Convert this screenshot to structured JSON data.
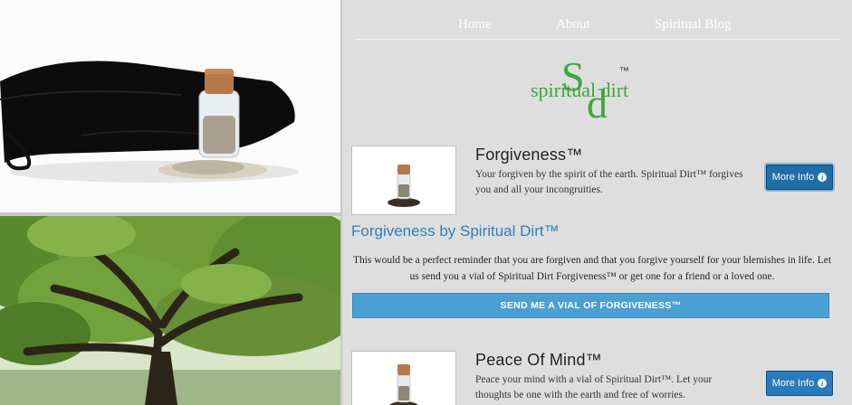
{
  "nav": {
    "home": "Home",
    "about": "About",
    "blog": "Spiritual Blog"
  },
  "logo": {
    "monogram_s": "S",
    "monogram_d": "d",
    "wordmark": "spiritual dirt",
    "tm": "™",
    "color": "#3aa83a"
  },
  "products": [
    {
      "title": "Forgiveness™",
      "description": "Your forgiven by the spirit of the earth. Spiritual Dirt™ forgives you and all your incongruities.",
      "button": "More Info"
    },
    {
      "title": "Peace Of Mind™",
      "description": "Peace your mind with a vial of Spiritual Dirt™. Let your thoughts be one with the earth and free of worries.",
      "button": "More Info"
    }
  ],
  "section": {
    "title": "Forgiveness by Spiritual Dirt™",
    "text": "This would be a perfect reminder that you are forgiven and that you forgive yourself for your blemishes in life. Let us send you a vial of Spiritual Dirt Forgiveness™ or get one for a friend or a loved one.",
    "cta": "SEND ME A VIAL OF FORGIVENESS™"
  },
  "colors": {
    "accent": "#2d7fb8",
    "button": "#1f6ea8",
    "cta": "#4a9fd3",
    "background": "#dedede"
  }
}
